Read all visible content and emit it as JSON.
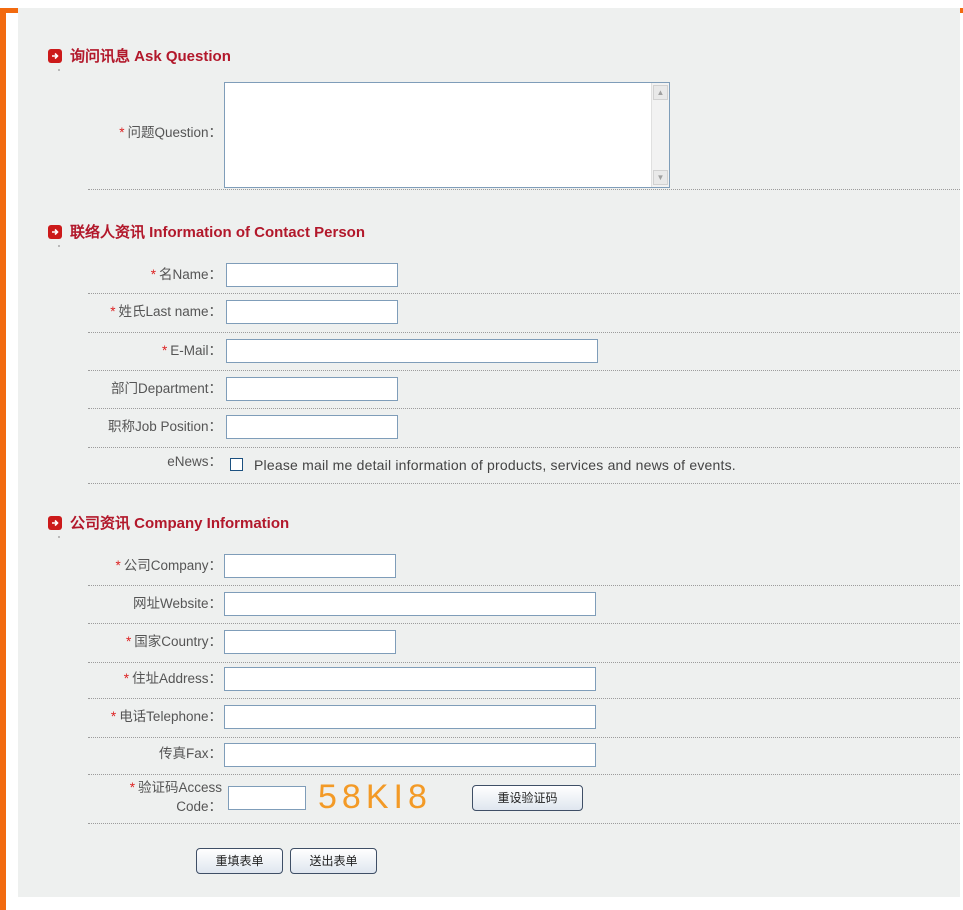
{
  "sections": {
    "ask": {
      "title": "询问讯息 Ask Question"
    },
    "contact": {
      "title": "联络人资讯 Information of Contact Person"
    },
    "company": {
      "title": "公司资讯 Company Information"
    }
  },
  "fields": {
    "question": {
      "label": "问题Question："
    },
    "name": {
      "label": "名Name："
    },
    "last_name": {
      "label": "姓氏Last name："
    },
    "email": {
      "label": "E-Mail："
    },
    "department": {
      "label": "部门Department："
    },
    "job_position": {
      "label": "职称Job Position："
    },
    "enews": {
      "label": "eNews：",
      "checkbox_text": "Please mail me detail information of products, services and news of events."
    },
    "company": {
      "label": "公司Company："
    },
    "website": {
      "label": "网址Website："
    },
    "country": {
      "label": "国家Country："
    },
    "address": {
      "label": "住址Address："
    },
    "telephone": {
      "label": "电话Telephone："
    },
    "fax": {
      "label": "传真Fax："
    },
    "access_code": {
      "label_line1": "验证码Access",
      "label_line2": "Code：",
      "captcha": "58KI8",
      "reset_button": "重设验证码"
    }
  },
  "required_marker": "*",
  "buttons": {
    "reset": "重填表单",
    "submit": "送出表单"
  },
  "icons": {
    "section_icon": "arrow-right-icon",
    "accent": "#f26a0f",
    "brand_red": "#b2182b"
  }
}
